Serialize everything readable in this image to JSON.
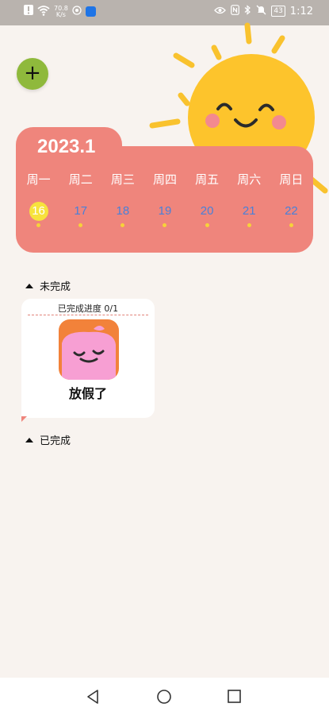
{
  "status_bar": {
    "network_speed_value": "70.8",
    "network_speed_unit": "K/s",
    "battery": "43",
    "time": "1:12"
  },
  "add_button": {
    "label": "+"
  },
  "calendar": {
    "year_month": "2023.1",
    "weekdays": [
      "周一",
      "周二",
      "周三",
      "周四",
      "周五",
      "周六",
      "周日"
    ],
    "dates": [
      "16",
      "17",
      "18",
      "19",
      "20",
      "21",
      "22"
    ],
    "today_index": 0,
    "colors": {
      "card": "#ef857c",
      "today": "#f7e23d",
      "date_text": "#4a80d8"
    }
  },
  "sections": {
    "incomplete_label": "未完成",
    "complete_label": "已完成"
  },
  "task": {
    "progress_label": "已完成进度 0/1",
    "title": "放假了"
  },
  "nav": {
    "back": "back-icon",
    "home": "home-icon",
    "recents": "recents-icon"
  }
}
